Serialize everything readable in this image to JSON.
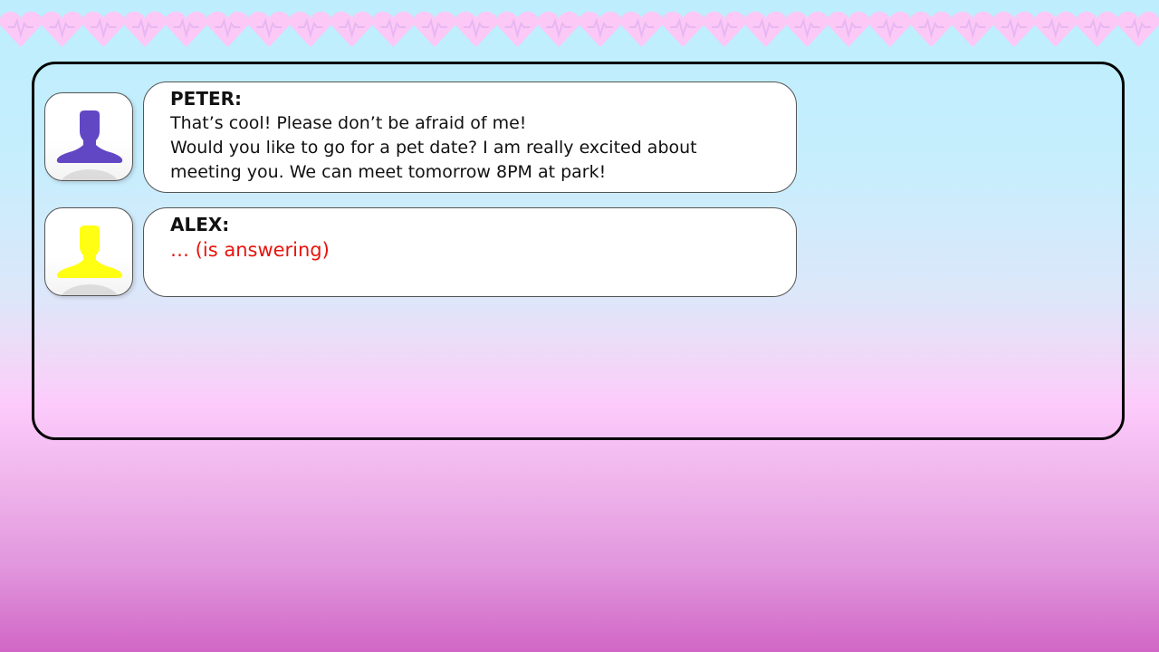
{
  "decoration": {
    "heart_color": "#fcc8f6",
    "heart_count": 28
  },
  "messages": [
    {
      "sender": "PETER:",
      "avatar_icon": "user-silhouette-icon",
      "avatar_color": "#6247c4",
      "lines": [
        "That’s cool! Please don’t be afraid of me!",
        "Would you like to go for a pet date? I am really excited about",
        "meeting you. We can meet tomorrow 8PM at park!"
      ]
    },
    {
      "sender": "ALEX:",
      "avatar_icon": "user-silhouette-icon",
      "avatar_color": "#ffff14",
      "status": "… (is answering)",
      "status_color": "#e8130b"
    }
  ]
}
